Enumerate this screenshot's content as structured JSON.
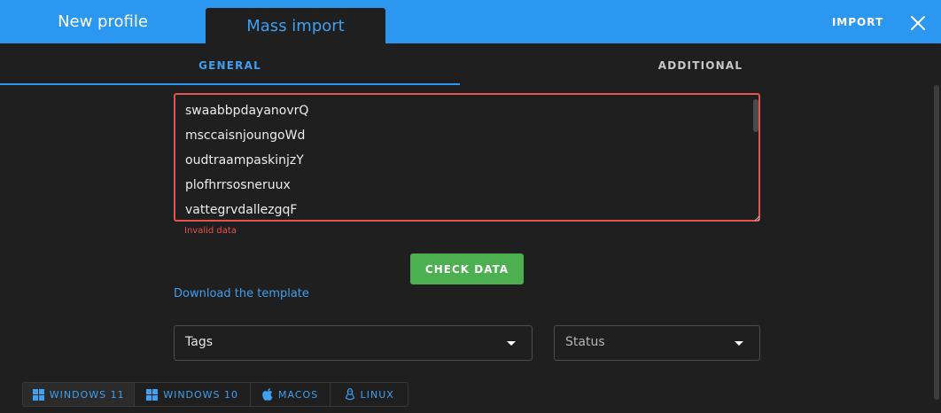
{
  "header": {
    "tabs": [
      {
        "label": "New profile",
        "active": false
      },
      {
        "label": "Mass import",
        "active": true
      }
    ],
    "import_label": "IMPORT",
    "close_icon": "close-icon",
    "accent_color": "#2c97f0"
  },
  "subtabs": [
    {
      "label": "GENERAL",
      "active": true
    },
    {
      "label": "ADDITIONAL",
      "active": false
    }
  ],
  "import_data": {
    "lines": [
      "swaabbpdayanovrQ",
      "msccaisnjoungoWd",
      "oudtraampaskinjzY",
      "plofhrrsosneruux",
      "vattegrvdallezgqF"
    ],
    "error": "Invalid data",
    "error_color": "#e5534f"
  },
  "check_button": {
    "label": "CHECK DATA",
    "color": "#4caf50"
  },
  "download_template_label": "Download the template",
  "selects": {
    "tags": {
      "placeholder": "Tags"
    },
    "status": {
      "placeholder": "Status"
    }
  },
  "os_options": [
    {
      "label": "WINDOWS 11",
      "icon": "windows-icon",
      "active": true
    },
    {
      "label": "WINDOWS 10",
      "icon": "windows-icon",
      "active": false
    },
    {
      "label": "MACOS",
      "icon": "apple-icon",
      "active": false
    },
    {
      "label": "LINUX",
      "icon": "linux-icon",
      "active": false
    }
  ]
}
